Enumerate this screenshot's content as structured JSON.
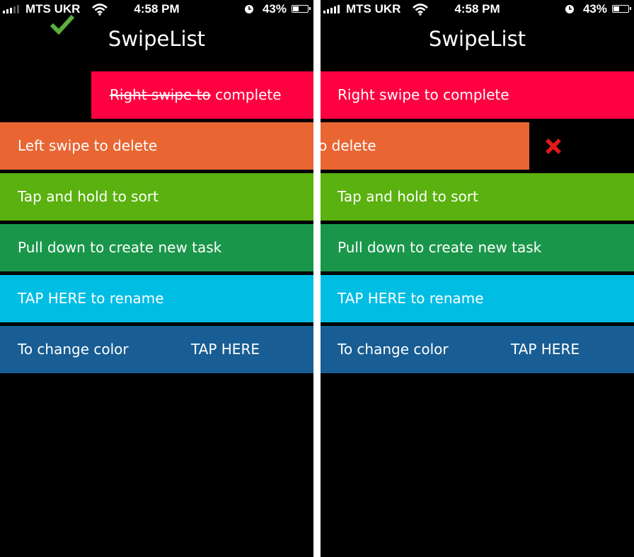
{
  "status": {
    "carrier": "MTS UKR",
    "time": "4:58 PM",
    "battery": "43%",
    "battery_level": 0.43
  },
  "app": {
    "title": "SwipeList"
  },
  "colors": {
    "red": "#ff0040",
    "orange": "#e96633",
    "lime": "#5ab10f",
    "green": "#1a964a",
    "cyan": "#00bde4",
    "blue": "#185d93",
    "check": "#5cae3d",
    "cross": "#e01a1a"
  },
  "tasks": {
    "complete": "Right swipe to complete",
    "delete": "Left swipe to delete",
    "sort": "Tap and hold to sort",
    "create": "Pull down to create new task",
    "rename": "TAP HERE to rename",
    "color_label": "To change color",
    "color_action": "TAP HERE"
  },
  "right_tasks": {
    "delete_fragment": "o delete"
  }
}
